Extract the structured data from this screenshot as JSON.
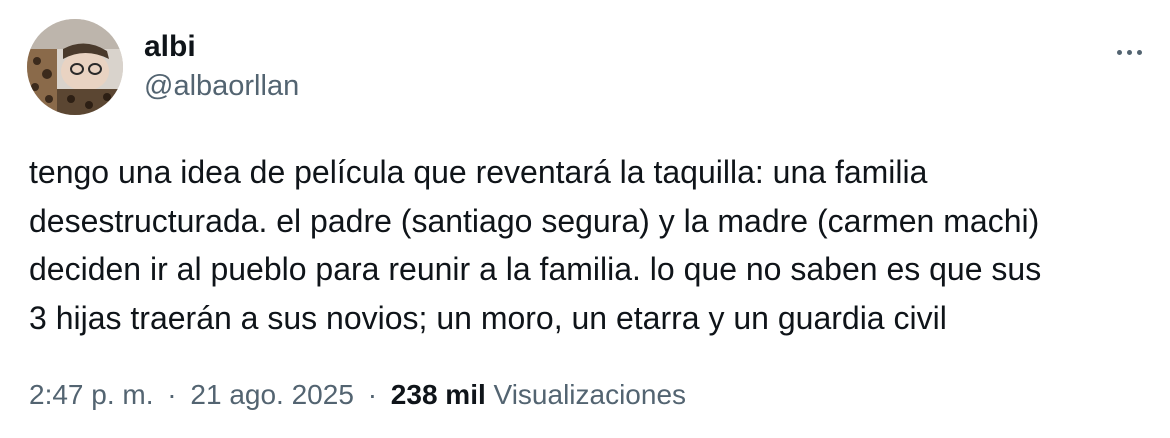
{
  "author": {
    "display_name": "albi",
    "handle": "@albaorllan",
    "avatar_icon": "profile-photo"
  },
  "actions": {
    "more_icon": "ellipsis-horizontal-icon"
  },
  "tweet": {
    "text_lines": [
      "tengo una idea de película que reventará la taquilla: una familia",
      "desestructurada. el padre (santiago segura) y la madre (carmen machi)",
      "deciden ir al pueblo para reunir a la familia. lo que no saben es que sus",
      "3 hijas traerán a sus novios; un moro, un etarra y un guardia civil"
    ]
  },
  "meta": {
    "time": "2:47 p. m.",
    "separator": "·",
    "date": "21 ago. 2025",
    "views_count": "238 mil",
    "views_label": "Visualizaciones"
  },
  "colors": {
    "text_primary": "#0f1419",
    "text_secondary": "#536471",
    "background": "#ffffff"
  }
}
